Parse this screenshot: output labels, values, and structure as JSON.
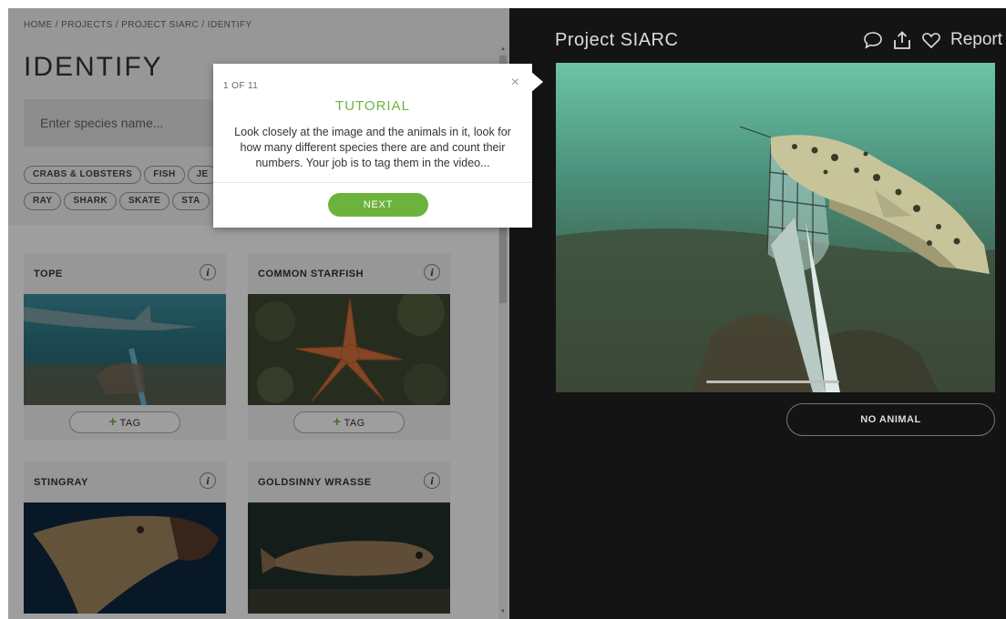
{
  "breadcrumb": "HOME / PROJECTS / PROJECT SIARC / IDENTIFY",
  "page_title": "IDENTIFY",
  "search": {
    "placeholder": "Enter species name..."
  },
  "filter_chips": [
    "CRABS & LOBSTERS",
    "FISH",
    "JE",
    "RAY",
    "SHARK",
    "SKATE",
    "STA"
  ],
  "species_cards": [
    {
      "name": "TOPE",
      "tag_label": "TAG"
    },
    {
      "name": "COMMON STARFISH",
      "tag_label": "TAG"
    },
    {
      "name": "STINGRAY"
    },
    {
      "name": "GOLDSINNY WRASSE"
    }
  ],
  "info_glyph": "i",
  "project": {
    "title": "Project SIARC",
    "report_label": "Report",
    "icons": [
      "comment-icon",
      "share-icon",
      "heart-icon"
    ]
  },
  "no_animal_label": "NO ANIMAL",
  "tutorial": {
    "step": "1 OF 11",
    "title": "TUTORIAL",
    "text": "Look closely at the image and the animals in it, look for how many different species there are and count their numbers. Your job is to tag them in the video...",
    "next_label": "NEXT",
    "close_glyph": "×"
  },
  "colors": {
    "accent_green": "#6cb33e",
    "dark_panel": "#141414"
  }
}
